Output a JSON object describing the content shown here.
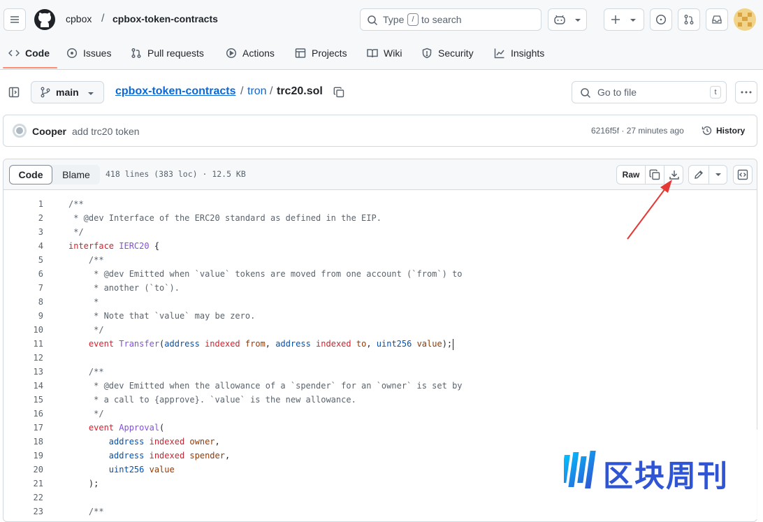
{
  "repo": {
    "owner": "cpbox",
    "sep": "/",
    "name": "cpbox-token-contracts"
  },
  "search": {
    "prefix": "Type",
    "key": "/",
    "suffix": "to search"
  },
  "tabs": [
    {
      "label": "Code"
    },
    {
      "label": "Issues"
    },
    {
      "label": "Pull requests"
    },
    {
      "label": "Actions"
    },
    {
      "label": "Projects"
    },
    {
      "label": "Wiki"
    },
    {
      "label": "Security"
    },
    {
      "label": "Insights"
    }
  ],
  "file_nav": {
    "branch": "main",
    "crumb_repo": "cpbox-token-contracts",
    "crumb_sep1": "/",
    "crumb_dir": "tron",
    "crumb_sep2": "/",
    "crumb_file": "trc20.sol",
    "go_to_file": "Go to file",
    "go_key": "t"
  },
  "commit": {
    "author": "Cooper",
    "message": "add trc20 token",
    "sha_time": "6216f5f · 27 minutes ago",
    "history": "History"
  },
  "code_toolbar": {
    "code": "Code",
    "blame": "Blame",
    "stats": "418 lines (383 loc) · 12.5 KB",
    "raw": "Raw"
  },
  "code_lines": [
    {
      "n": "1",
      "s": [
        {
          "t": "/**",
          "c": "c"
        }
      ]
    },
    {
      "n": "2",
      "s": [
        {
          "t": " * @dev Interface of the ERC20 standard as defined in the EIP.",
          "c": "c"
        }
      ]
    },
    {
      "n": "3",
      "s": [
        {
          "t": " */",
          "c": "c"
        }
      ]
    },
    {
      "n": "4",
      "s": [
        {
          "t": "interface ",
          "c": "k"
        },
        {
          "t": "IERC20",
          "c": "f"
        },
        {
          "t": " {",
          "c": ""
        }
      ]
    },
    {
      "n": "5",
      "s": [
        {
          "t": "    /**",
          "c": "c"
        }
      ]
    },
    {
      "n": "6",
      "s": [
        {
          "t": "     * @dev Emitted when `value` tokens are moved from one account (`from`) to",
          "c": "c"
        }
      ]
    },
    {
      "n": "7",
      "s": [
        {
          "t": "     * another (`to`).",
          "c": "c"
        }
      ]
    },
    {
      "n": "8",
      "s": [
        {
          "t": "     *",
          "c": "c"
        }
      ]
    },
    {
      "n": "9",
      "s": [
        {
          "t": "     * Note that `value` may be zero.",
          "c": "c"
        }
      ]
    },
    {
      "n": "10",
      "s": [
        {
          "t": "     */",
          "c": "c"
        }
      ]
    },
    {
      "n": "11",
      "s": [
        {
          "t": "    event ",
          "c": "k"
        },
        {
          "t": "Transfer",
          "c": "f"
        },
        {
          "t": "(",
          "c": ""
        },
        {
          "t": "address",
          "c": "t"
        },
        {
          "t": " indexed ",
          "c": "k"
        },
        {
          "t": "from",
          "c": "v"
        },
        {
          "t": ", ",
          "c": ""
        },
        {
          "t": "address",
          "c": "t"
        },
        {
          "t": " indexed ",
          "c": "k"
        },
        {
          "t": "to",
          "c": "v"
        },
        {
          "t": ", ",
          "c": ""
        },
        {
          "t": "uint256",
          "c": "t"
        },
        {
          "t": " value",
          "c": "v"
        },
        {
          "t": ");",
          "c": ""
        }
      ]
    },
    {
      "n": "12",
      "s": []
    },
    {
      "n": "13",
      "s": [
        {
          "t": "    /**",
          "c": "c"
        }
      ]
    },
    {
      "n": "14",
      "s": [
        {
          "t": "     * @dev Emitted when the allowance of a `spender` for an `owner` is set by",
          "c": "c"
        }
      ]
    },
    {
      "n": "15",
      "s": [
        {
          "t": "     * a call to {approve}. `value` is the new allowance.",
          "c": "c"
        }
      ]
    },
    {
      "n": "16",
      "s": [
        {
          "t": "     */",
          "c": "c"
        }
      ]
    },
    {
      "n": "17",
      "s": [
        {
          "t": "    event ",
          "c": "k"
        },
        {
          "t": "Approval",
          "c": "f"
        },
        {
          "t": "(",
          "c": ""
        }
      ]
    },
    {
      "n": "18",
      "s": [
        {
          "t": "        address",
          "c": "t"
        },
        {
          "t": " indexed ",
          "c": "k"
        },
        {
          "t": "owner",
          "c": "v"
        },
        {
          "t": ",",
          "c": ""
        }
      ]
    },
    {
      "n": "19",
      "s": [
        {
          "t": "        address",
          "c": "t"
        },
        {
          "t": " indexed ",
          "c": "k"
        },
        {
          "t": "spender",
          "c": "v"
        },
        {
          "t": ",",
          "c": ""
        }
      ]
    },
    {
      "n": "20",
      "s": [
        {
          "t": "        uint256",
          "c": "t"
        },
        {
          "t": " value",
          "c": "v"
        }
      ]
    },
    {
      "n": "21",
      "s": [
        {
          "t": "    );",
          "c": ""
        }
      ]
    },
    {
      "n": "22",
      "s": []
    },
    {
      "n": "23",
      "s": [
        {
          "t": "    /**",
          "c": "c"
        }
      ]
    }
  ],
  "watermark": {
    "text": "区块周刊"
  }
}
